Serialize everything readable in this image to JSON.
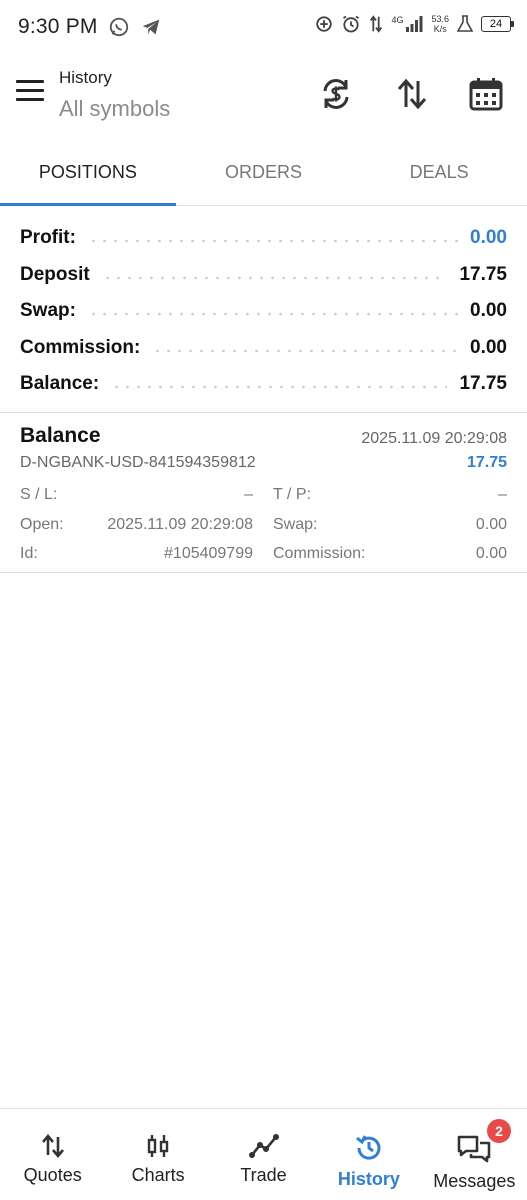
{
  "status_bar": {
    "time": "9:30 PM",
    "network_type": "4G",
    "net_speed_value": "53.6",
    "net_speed_unit": "K/s",
    "battery": "24"
  },
  "header": {
    "title": "History",
    "subtitle": "All symbols"
  },
  "tabs": [
    {
      "label": "POSITIONS",
      "active": true
    },
    {
      "label": "ORDERS",
      "active": false
    },
    {
      "label": "DEALS",
      "active": false
    }
  ],
  "summary": {
    "rows": [
      {
        "label": "Profit:",
        "value": "0.00"
      },
      {
        "label": "Deposit",
        "value": "17.75"
      },
      {
        "label": "Swap:",
        "value": "0.00"
      },
      {
        "label": "Commission:",
        "value": "0.00"
      },
      {
        "label": "Balance:",
        "value": "17.75"
      }
    ]
  },
  "deal": {
    "title": "Balance",
    "time": "2025.11.09 20:29:08",
    "comment": "D-NGBANK-USD-841594359812",
    "amount": "17.75",
    "rows": [
      {
        "l1": "S / L:",
        "v1": "–",
        "l2": "T / P:",
        "v2": "–"
      },
      {
        "l1": "Open:",
        "v1": "2025.11.09 20:29:08",
        "l2": "Swap:",
        "v2": "0.00"
      },
      {
        "l1": "Id:",
        "v1": "#105409799",
        "l2": "Commission:",
        "v2": "0.00"
      }
    ]
  },
  "bottom_nav": {
    "items": [
      {
        "label": "Quotes",
        "icon": "quotes-icon"
      },
      {
        "label": "Charts",
        "icon": "charts-icon"
      },
      {
        "label": "Trade",
        "icon": "trade-icon"
      },
      {
        "label": "History",
        "icon": "history-icon",
        "active": true
      },
      {
        "label": "Messages",
        "icon": "messages-icon",
        "badge": "2"
      }
    ]
  },
  "colors": {
    "accent": "#2f7ed8",
    "badge": "#e84a4a"
  }
}
